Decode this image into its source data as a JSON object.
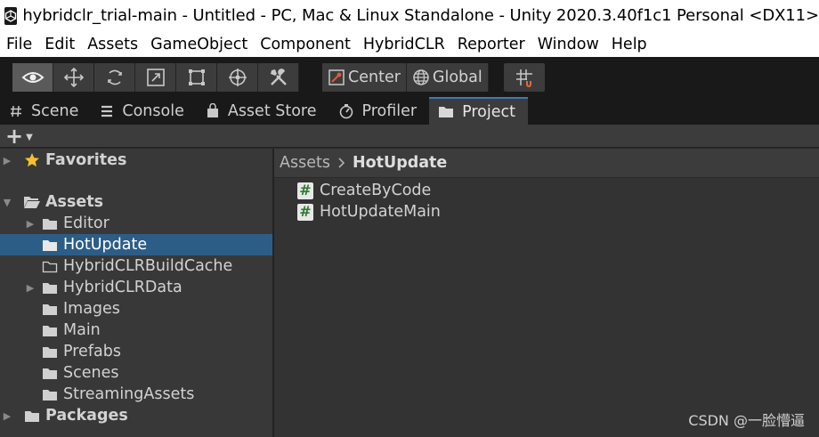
{
  "window": {
    "title": "hybridclr_trial-main - Untitled - PC, Mac & Linux Standalone - Unity 2020.3.40f1c1 Personal <DX11>",
    "icon": "unity-icon"
  },
  "menubar": {
    "items": [
      "File",
      "Edit",
      "Assets",
      "GameObject",
      "Component",
      "HybridCLR",
      "Reporter",
      "Window",
      "Help"
    ]
  },
  "toolbar": {
    "tools": [
      {
        "name": "view-tool",
        "icon": "eye-icon",
        "active": true
      },
      {
        "name": "move-tool",
        "icon": "move-arrows-icon",
        "active": false
      },
      {
        "name": "rotate-tool",
        "icon": "rotate-icon",
        "active": false
      },
      {
        "name": "scale-tool",
        "icon": "scale-icon",
        "active": false
      },
      {
        "name": "rect-tool",
        "icon": "rect-icon",
        "active": false
      },
      {
        "name": "transform-tool",
        "icon": "transform-icon",
        "active": false
      },
      {
        "name": "custom-tool",
        "icon": "tools-icon",
        "active": false
      }
    ],
    "pivot_label": "Center",
    "rotation_label": "Global"
  },
  "tabs": [
    {
      "label": "Scene",
      "icon": "hash-icon",
      "active": false
    },
    {
      "label": "Console",
      "icon": "console-icon",
      "active": false
    },
    {
      "label": "Asset Store",
      "icon": "bag-icon",
      "active": false
    },
    {
      "label": "Profiler",
      "icon": "profiler-icon",
      "active": false
    },
    {
      "label": "Project",
      "icon": "folder-icon",
      "active": true
    }
  ],
  "project": {
    "create_label": "+",
    "tree": [
      {
        "label": "Favorites",
        "icon": "star-icon",
        "level": 0,
        "bold": true,
        "arrow": "right",
        "selected": false
      },
      {
        "label": "Assets",
        "icon": "folder-open-icon",
        "level": 0,
        "bold": true,
        "arrow": "down",
        "selected": false
      },
      {
        "label": "Editor",
        "icon": "folder-icon",
        "level": 1,
        "bold": false,
        "arrow": "right",
        "selected": false
      },
      {
        "label": "HotUpdate",
        "icon": "folder-icon",
        "level": 1,
        "bold": false,
        "arrow": "none",
        "selected": true
      },
      {
        "label": "HybridCLRBuildCache",
        "icon": "folder-empty-icon",
        "level": 1,
        "bold": false,
        "arrow": "none",
        "selected": false
      },
      {
        "label": "HybridCLRData",
        "icon": "folder-icon",
        "level": 1,
        "bold": false,
        "arrow": "right",
        "selected": false
      },
      {
        "label": "Images",
        "icon": "folder-icon",
        "level": 1,
        "bold": false,
        "arrow": "none",
        "selected": false
      },
      {
        "label": "Main",
        "icon": "folder-icon",
        "level": 1,
        "bold": false,
        "arrow": "none",
        "selected": false
      },
      {
        "label": "Prefabs",
        "icon": "folder-icon",
        "level": 1,
        "bold": false,
        "arrow": "none",
        "selected": false
      },
      {
        "label": "Scenes",
        "icon": "folder-icon",
        "level": 1,
        "bold": false,
        "arrow": "none",
        "selected": false
      },
      {
        "label": "StreamingAssets",
        "icon": "folder-icon",
        "level": 1,
        "bold": false,
        "arrow": "none",
        "selected": false
      },
      {
        "label": "Packages",
        "icon": "folder-icon",
        "level": 0,
        "bold": true,
        "arrow": "right",
        "selected": false
      }
    ],
    "breadcrumb": [
      "Assets",
      "HotUpdate"
    ],
    "files": [
      {
        "label": "CreateByCode",
        "icon": "csharp-script-icon"
      },
      {
        "label": "HotUpdateMain",
        "icon": "csharp-script-icon"
      }
    ]
  },
  "watermark": "CSDN @一脸懵逼"
}
